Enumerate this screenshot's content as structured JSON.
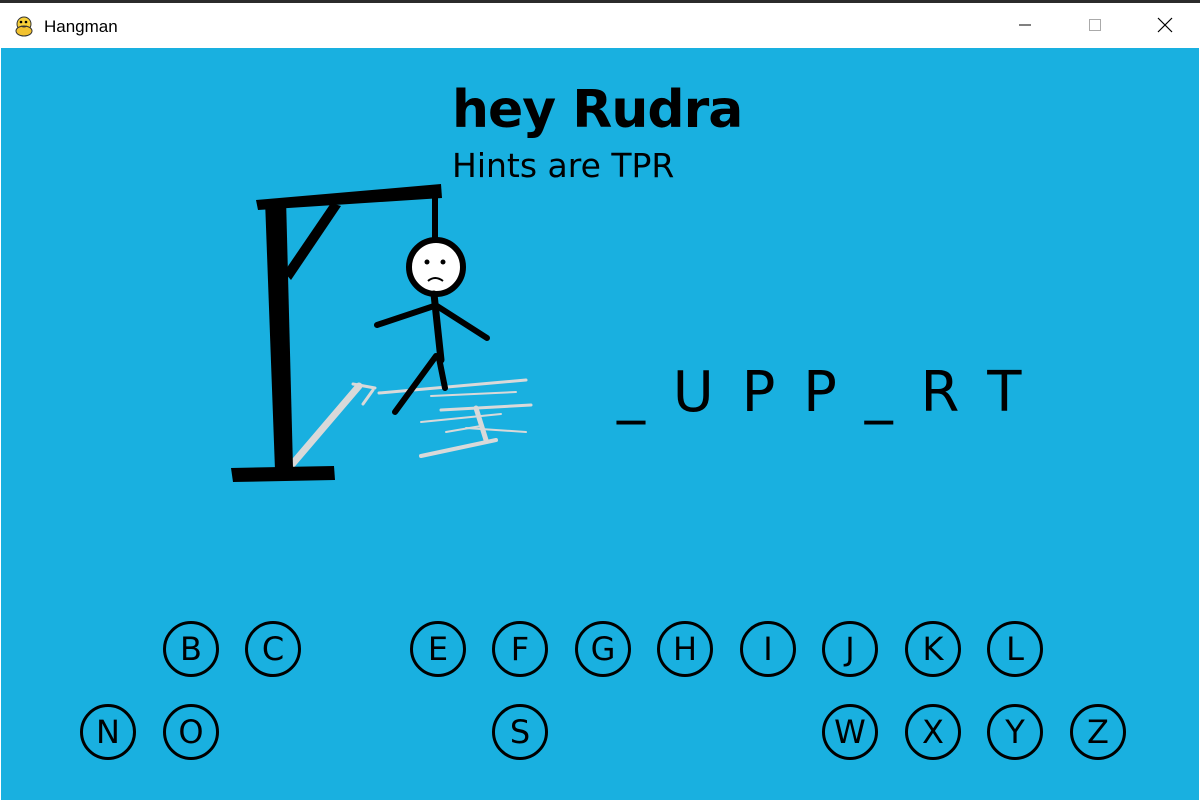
{
  "window": {
    "title": "Hangman",
    "icon": "python-snake-icon",
    "controls": [
      "minimize-icon",
      "maximize-icon",
      "close-icon"
    ]
  },
  "game": {
    "greeting": "hey Rudra",
    "hint": "Hints are TPR",
    "word_display": "_UPP_RT",
    "background_color": "#19b0e0",
    "hangman_stage": "complete-figure-sad-face",
    "letters": [
      {
        "label": "B"
      },
      {
        "label": "C"
      },
      {
        "label": "E"
      },
      {
        "label": "F"
      },
      {
        "label": "G"
      },
      {
        "label": "H"
      },
      {
        "label": "I"
      },
      {
        "label": "J"
      },
      {
        "label": "K"
      },
      {
        "label": "L"
      },
      {
        "label": "N"
      },
      {
        "label": "O"
      },
      {
        "label": "S"
      },
      {
        "label": "W"
      },
      {
        "label": "X"
      },
      {
        "label": "Y"
      },
      {
        "label": "Z"
      }
    ]
  }
}
